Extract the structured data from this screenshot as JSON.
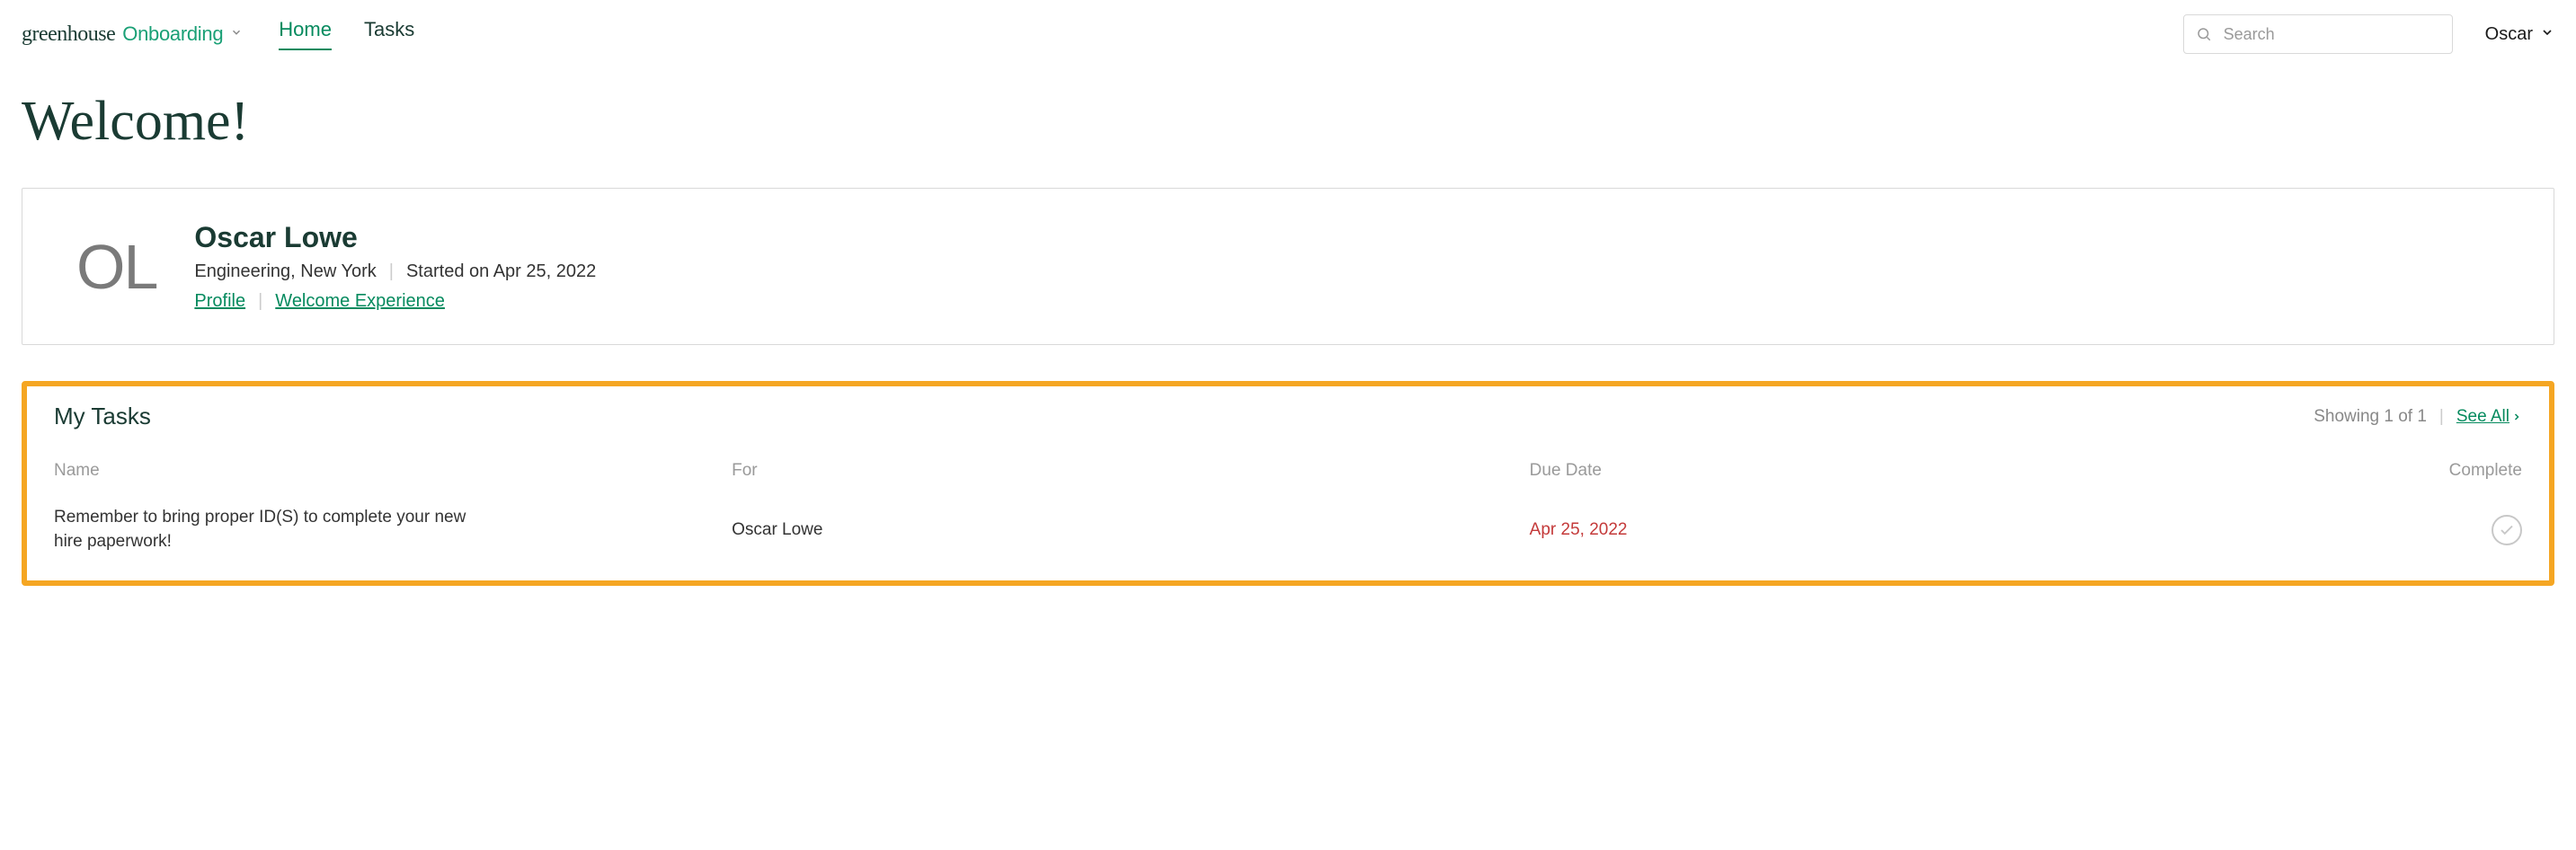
{
  "brand": {
    "greenhouse": "greenhouse",
    "onboarding": "Onboarding"
  },
  "nav": {
    "home": "Home",
    "tasks": "Tasks"
  },
  "search": {
    "placeholder": "Search"
  },
  "user": {
    "name": "Oscar"
  },
  "page": {
    "title": "Welcome!"
  },
  "profile": {
    "initials": "OL",
    "name": "Oscar Lowe",
    "dept_loc": "Engineering, New York",
    "started": "Started on Apr 25, 2022",
    "links": {
      "profile": "Profile",
      "welcome": "Welcome Experience"
    }
  },
  "tasks": {
    "title": "My Tasks",
    "showing": "Showing 1 of 1",
    "see_all": "See All",
    "columns": {
      "name": "Name",
      "for": "For",
      "due": "Due Date",
      "complete": "Complete"
    },
    "rows": [
      {
        "name": "Remember to bring proper ID(S) to complete your new hire paperwork!",
        "for": "Oscar Lowe",
        "due": "Apr 25, 2022",
        "overdue": true
      }
    ]
  }
}
